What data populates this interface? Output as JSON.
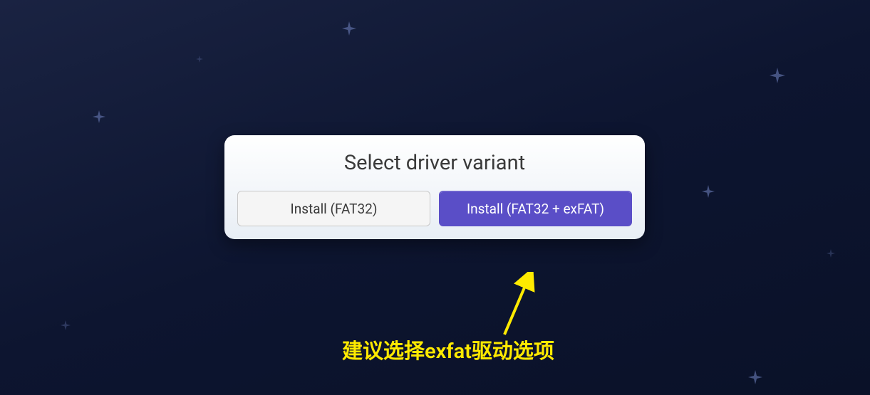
{
  "dialog": {
    "title": "Select driver variant",
    "buttons": {
      "fat32": "Install (FAT32)",
      "exfat": "Install (FAT32 + exFAT)"
    }
  },
  "annotation": {
    "text": "建议选择exfat驱动选项"
  }
}
